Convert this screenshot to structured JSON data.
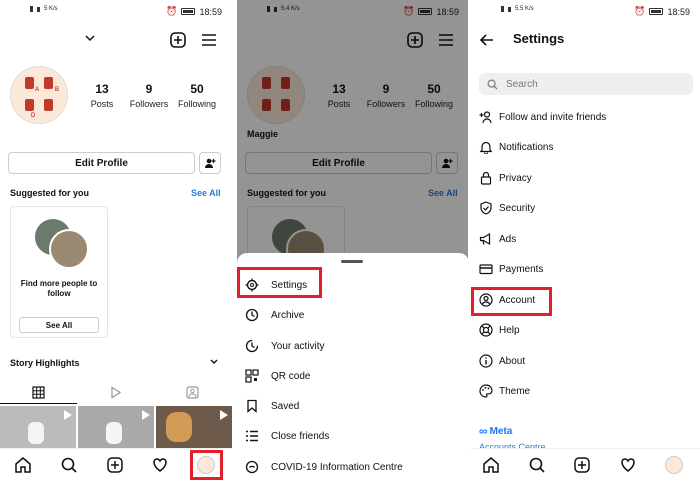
{
  "status_bar": {
    "time": "18:59",
    "left_text": "4G",
    "net_p2": "5.4 K/s",
    "net_p1": "5 K/s",
    "net_p3": "5.5 K/s"
  },
  "profile": {
    "username": "Maggie",
    "posts": {
      "count": "13",
      "label": "Posts"
    },
    "followers": {
      "count": "9",
      "label": "Followers"
    },
    "following": {
      "count": "50",
      "label": "Following"
    },
    "edit_profile_label": "Edit Profile",
    "suggested_label": "Suggested for you",
    "see_all_link": "See All",
    "card_text": "Find more people to follow",
    "card_button": "See All",
    "highlights_label": "Story Highlights",
    "avatar_letters": [
      "A",
      "B",
      "C",
      "D"
    ]
  },
  "menu_sheet": {
    "items": [
      {
        "label": "Settings",
        "icon": "settings-icon"
      },
      {
        "label": "Archive",
        "icon": "archive-icon"
      },
      {
        "label": "Your activity",
        "icon": "activity-icon"
      },
      {
        "label": "QR code",
        "icon": "qr-code-icon"
      },
      {
        "label": "Saved",
        "icon": "bookmark-icon"
      },
      {
        "label": "Close friends",
        "icon": "close-friends-icon"
      },
      {
        "label": "COVID-19 Information Centre",
        "icon": "covid-icon"
      }
    ]
  },
  "settings": {
    "title": "Settings",
    "search_placeholder": "Search",
    "items": [
      {
        "label": "Follow and invite friends",
        "icon": "add-person-icon"
      },
      {
        "label": "Notifications",
        "icon": "bell-icon"
      },
      {
        "label": "Privacy",
        "icon": "lock-icon"
      },
      {
        "label": "Security",
        "icon": "shield-icon"
      },
      {
        "label": "Ads",
        "icon": "megaphone-icon"
      },
      {
        "label": "Payments",
        "icon": "card-icon"
      },
      {
        "label": "Account",
        "icon": "user-circle-icon"
      },
      {
        "label": "Help",
        "icon": "lifebuoy-icon"
      },
      {
        "label": "About",
        "icon": "info-icon"
      },
      {
        "label": "Theme",
        "icon": "palette-icon"
      }
    ],
    "meta_label": "Meta",
    "accounts_centre": "Accounts Centre"
  },
  "colors": {
    "highlight": "#e0202a",
    "link": "#2e7dd4",
    "meta": "#1877f2"
  }
}
